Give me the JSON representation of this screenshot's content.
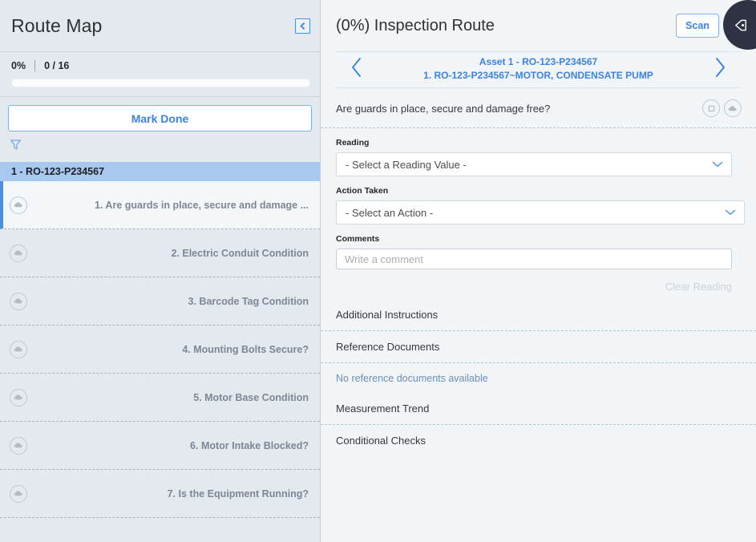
{
  "left_panel": {
    "title": "Route Map",
    "collapse_icon": "chevron-left-icon",
    "progress": {
      "percent_label": "0%",
      "count_label": "0 / 16",
      "percent_value": 0
    },
    "mark_done_label": "Mark Done",
    "filter_icon": "filter-funnel-icon",
    "asset_group_label": "1 - RO-123-P234567",
    "tasks": [
      {
        "label": "1. Are guards in place, secure and damage ...",
        "icon": "cloud-upload-icon",
        "selected": true
      },
      {
        "label": "2. Electric Conduit Condition",
        "icon": "cloud-upload-icon",
        "selected": false
      },
      {
        "label": "3. Barcode Tag Condition",
        "icon": "cloud-upload-icon",
        "selected": false
      },
      {
        "label": "4. Mounting Bolts Secure?",
        "icon": "cloud-upload-icon",
        "selected": false
      },
      {
        "label": "5. Motor Base Condition",
        "icon": "cloud-upload-icon",
        "selected": false
      },
      {
        "label": "6. Motor Intake Blocked?",
        "icon": "cloud-upload-icon",
        "selected": false
      },
      {
        "label": "7. Is the Equipment Running?",
        "icon": "cloud-upload-icon",
        "selected": false
      }
    ]
  },
  "right_panel": {
    "title": "(0%) Inspection Route",
    "scan_label": "Scan",
    "side_tab_icon": "tag-icon",
    "asset_nav": {
      "prev_icon": "chevron-left-icon",
      "next_icon": "chevron-right-icon",
      "line1": "Asset 1 - RO-123-P234567",
      "line2": "1. RO-123-P234567~MOTOR, CONDENSATE PUMP"
    },
    "question": {
      "text": "Are guards in place, secure and damage free?",
      "icons": [
        "camera-icon",
        "cloud-upload-icon"
      ]
    },
    "reading": {
      "label": "Reading",
      "value": "- Select a Reading Value -",
      "chevron_icon": "chevron-down-icon"
    },
    "action_taken": {
      "label": "Action Taken",
      "value": "- Select an Action -",
      "chevron_icon": "chevron-down-icon"
    },
    "comments": {
      "label": "Comments",
      "placeholder": "Write a comment",
      "value": ""
    },
    "clear_reading_label": "Clear Reading",
    "sections": [
      {
        "label": "Additional Instructions"
      },
      {
        "label": "Reference Documents"
      }
    ],
    "reference_empty_note": "No reference documents available",
    "measurement_trend_label": "Measurement Trend",
    "conditional_checks_label": "Conditional Checks"
  },
  "colors": {
    "accent_blue": "#3b82e6",
    "panel_bg": "#e4e9f0",
    "right_bg": "#f2f5f8",
    "group_header": "#a9c8ef",
    "side_tab_dark": "#2e3243"
  }
}
